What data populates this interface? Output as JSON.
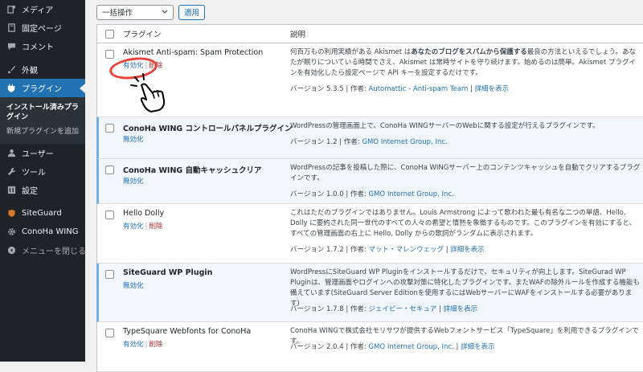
{
  "sidebar": {
    "items_top": [
      {
        "icon": "media-icon",
        "label": "メディア"
      },
      {
        "icon": "page-icon",
        "label": "固定ページ"
      },
      {
        "icon": "comment-icon",
        "label": "コメント"
      }
    ],
    "appearance": {
      "icon": "brush-icon",
      "label": "外観"
    },
    "plugins": {
      "icon": "plugin-icon",
      "label": "プラグイン"
    },
    "plugins_sub": [
      "インストール済みプラグイン",
      "新規プラグインを追加"
    ],
    "items_bottom": [
      {
        "icon": "user-icon",
        "label": "ユーザー"
      },
      {
        "icon": "wrench-icon",
        "label": "ツール"
      },
      {
        "icon": "settings-icon",
        "label": "設定"
      }
    ],
    "extra": [
      {
        "icon": "siteguard-icon",
        "label": "SiteGuard"
      },
      {
        "icon": "gear-icon",
        "label": "ConoHa WING"
      }
    ],
    "collapse": {
      "icon": "collapse-icon",
      "label": "メニューを閉じる"
    }
  },
  "toolbar": {
    "bulk_action": "一括操作",
    "apply": "適用"
  },
  "table": {
    "col_plugin": "プラグイン",
    "col_desc": "説明",
    "rows": [
      {
        "name": "Akismet Anti-spam: Spam Protection",
        "active": false,
        "actions": [
          "有効化",
          "削除"
        ],
        "description": "何百万もの利用実績がある Akismet は<b>あなたのブログをスパムから保護する</b>最良の方法といえるでしょう。あなたが眠りについている時間でさえ、Akismet は常時サイトを守り続けます。始めるのは簡単。Akismet プラグインを有効化したら設定ページで API キーを設定するだけです。",
        "version_text": "バージョン 5.3.5 | 作者: ",
        "author": "Automattic - Anti-spam Team",
        "details": "詳細を表示"
      },
      {
        "name": "ConoHa WING コントロールパネルプラグイン",
        "active": true,
        "actions": [
          "無効化"
        ],
        "description": "WordPressの管理画面上で、ConoHa WINGサーバーのWebに関する設定が行えるプラグインです。",
        "version_text": "バージョン 1.2 | 作者: ",
        "author": "GMO Internet Group, Inc.",
        "details": ""
      },
      {
        "name": "ConoHa WING 自動キャッシュクリア",
        "active": true,
        "actions": [
          "無効化"
        ],
        "description": "WordPressの記事を投稿した際に、ConoHa WINGサーバー上のコンテンツキャッシュを自動でクリアするプラグインです。",
        "version_text": "バージョン 1.0.0 | 作者: ",
        "author": "GMO Internet Group, Inc.",
        "details": ""
      },
      {
        "name": "Hello Dolly",
        "active": false,
        "actions": [
          "有効化",
          "削除"
        ],
        "description": "これはただのプラグインではありません。Louis Armstrong によって歌われた最も有名な二つの単語、Hello, Dolly に要約された同一世代のすべての人々の希望と情熱を象徴するものです。このプラグインを有効にすると、すべての管理画面の右上に Hello, Dolly からの歌詞がランダムに表示されます。",
        "version_text": "バージョン 1.7.2 | 作者: ",
        "author": "マット・マレンウェッグ",
        "details": "詳細を表示"
      },
      {
        "name": "SiteGuard WP Plugin",
        "active": true,
        "actions": [
          "無効化"
        ],
        "description": "WordPressにSiteGuard WP Pluginをインストールするだけで、セキュリティが向上します。SiteGurad WP Pluginは、管理画面やログインへの攻撃対策に特化したプラグインです。またWAFの除外ルールを作成する機能も備えています(SiteGuard Server Editionを使用するにはWebサーバーにWAFをインストールする必要があります)",
        "version_text": "バージョン 1.7.8 | 作者: ",
        "author": "ジェイピー・セキュア",
        "details": "詳細を表示"
      },
      {
        "name": "TypeSquare Webfonts for ConoHa",
        "active": false,
        "actions": [
          "有効化",
          "削除"
        ],
        "description": "ConoHa WINGで株式会社モリサワが提供するWebフォントサービス「TypeSquare」を利用できるプラグインです。",
        "version_text": "バージョン 2.0.4 | 作者: ",
        "author": "GMO Internet Group, Inc.",
        "details": "詳細を表示"
      }
    ]
  },
  "colors": {
    "accent": "#2271b1",
    "delete": "#b32d2e",
    "sidebar_bg": "#1d2327",
    "highlight_circle": "#e8413a"
  }
}
